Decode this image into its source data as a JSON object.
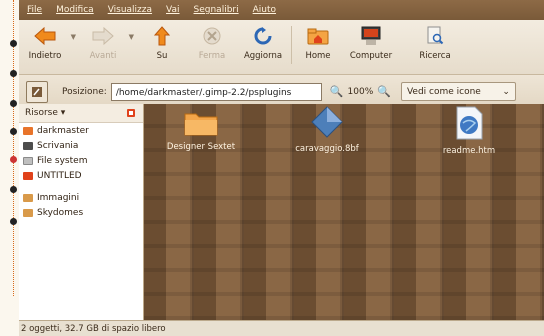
{
  "menubar": {
    "items": [
      "File",
      "Modifica",
      "Visualizza",
      "Vai",
      "Segnalibri",
      "Aiuto"
    ]
  },
  "toolbar": {
    "back_label": "Indietro",
    "forward_label": "Avanti",
    "up_label": "Su",
    "stop_label": "Ferma",
    "reload_label": "Aggiorna",
    "home_label": "Home",
    "computer_label": "Computer",
    "search_label": "Ricerca"
  },
  "location": {
    "label": "Posizione:",
    "path": "/home/darkmaster/.gimp-2.2/psplugins",
    "zoom": "100%",
    "view_mode": "Vedi come icone"
  },
  "sidebar": {
    "header": "Risorse",
    "places": [
      "darkmaster",
      "Scrivania",
      "File system",
      "UNTITLED"
    ],
    "bookmarks": [
      "Immagini",
      "Skydomes"
    ]
  },
  "files": [
    {
      "name": "Designer Sextet",
      "icon": "folder-icon"
    },
    {
      "name": "caravaggio.8bf",
      "icon": "plugin-diamond-icon"
    },
    {
      "name": "readme.htm",
      "icon": "html-document-icon"
    }
  ],
  "status": {
    "text": "2 oggetti, 32.7 GB di spazio libero"
  },
  "colors": {
    "menubar": "#7a5a39",
    "accent": "#e0421b",
    "content_bg": "#7b5a3a"
  }
}
